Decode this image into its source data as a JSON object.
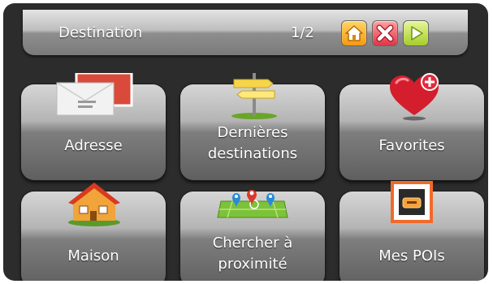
{
  "header": {
    "title": "Destination",
    "page_indicator": "1/2",
    "buttons": [
      {
        "name": "home-button",
        "icon": "home-icon",
        "color": "#f59a12"
      },
      {
        "name": "close-button",
        "icon": "close-icon",
        "color": "#e03545"
      },
      {
        "name": "next-button",
        "icon": "play-arrow-icon",
        "color": "#a5cd2a"
      }
    ]
  },
  "tiles": [
    {
      "label": "Adresse",
      "icon": "envelope-icon"
    },
    {
      "label_line1": "Dernières",
      "label_line2": "destinations",
      "icon": "signpost-icon"
    },
    {
      "label": "Favorites",
      "icon": "heart-plus-icon"
    },
    {
      "label": "Maison",
      "icon": "house-icon"
    },
    {
      "label_line1": "Chercher à",
      "label_line2": "proximité",
      "icon": "map-pins-icon"
    },
    {
      "label": "Mes POIs",
      "icon": "poi-frame-icon"
    }
  ]
}
